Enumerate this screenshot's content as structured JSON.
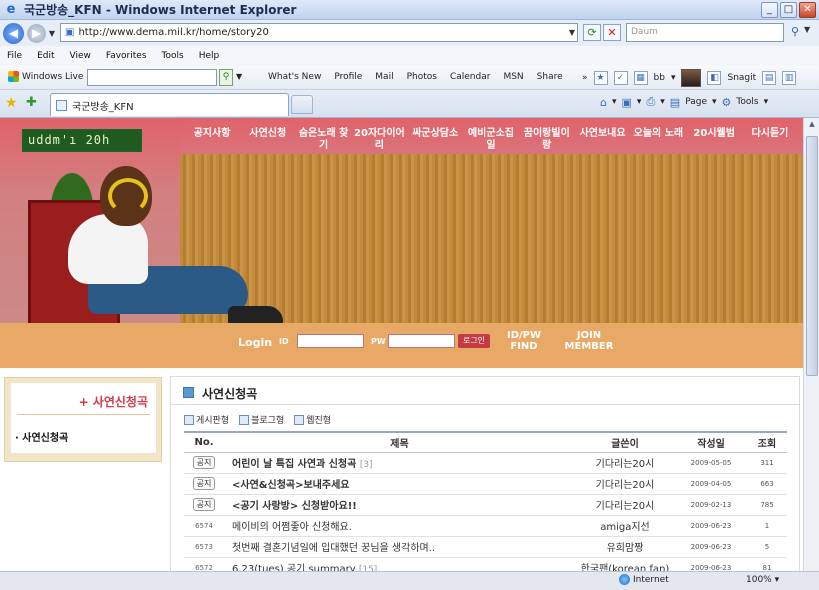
{
  "window": {
    "title": "국군방송_KFN - Windows Internet Explorer"
  },
  "address": {
    "url": "http://www.dema.mil.kr/home/story20",
    "search_placeholder": "Daum"
  },
  "menu": [
    "File",
    "Edit",
    "View",
    "Favorites",
    "Tools",
    "Help"
  ],
  "live_toolbar": {
    "brand": "Windows Live",
    "links": [
      "What's New",
      "Profile",
      "Mail",
      "Photos",
      "Calendar",
      "MSN",
      "Share"
    ],
    "user": "bb",
    "snagit": "Snagit"
  },
  "tabs": [
    {
      "label": "국군방송_KFN"
    }
  ],
  "command_bar": {
    "page": "Page",
    "tools": "Tools"
  },
  "site": {
    "logo": "uddm'ı 20h",
    "nav": [
      "공지사항",
      "사연신청",
      "숨은노래 찾기",
      "20자다이어리",
      "싸군상담소",
      "예비군소집일",
      "꿈이랑빌이랑",
      "사연보내요",
      "오늘의 노래",
      "20시웰범",
      "다시듣기"
    ],
    "login": {
      "label": "Login",
      "id_label": "ID",
      "pw_label": "PW",
      "button": "로그인",
      "find": "ID/PW FIND",
      "join": "JOIN MEMBER"
    }
  },
  "sidebar": {
    "title": "+ 사연신청곡",
    "items": [
      "· 사연신청곡"
    ]
  },
  "board": {
    "title": "사연신청곡",
    "view_tabs": [
      "게시판형",
      "블로그형",
      "웹진형"
    ],
    "columns": [
      "No.",
      "제목",
      "글쓴이",
      "작성일",
      "조회"
    ],
    "rows": [
      {
        "no": "공지",
        "notice": true,
        "title": "어린이 날 특집 사연과 신청곡",
        "comments": "[3]",
        "author": "기다리는20시",
        "date": "2009-05-05",
        "hits": "311"
      },
      {
        "no": "공지",
        "notice": true,
        "title": "<사연&신청곡>보내주세요",
        "comments": "",
        "author": "기다리는20시",
        "date": "2009-04-05",
        "hits": "663"
      },
      {
        "no": "공지",
        "notice": true,
        "title": "<공기 사랑방> 신청받아요!!",
        "comments": "",
        "author": "기다리는20시",
        "date": "2009-02-13",
        "hits": "785"
      },
      {
        "no": "6574",
        "notice": false,
        "title": "메이비의 어쩜좋아 신청해요.",
        "comments": "",
        "author": "amiga지선",
        "date": "2009-06-23",
        "hits": "1"
      },
      {
        "no": "6573",
        "notice": false,
        "title": "첫번째 결혼기념일에 입대했던 꿍님을 생각하며..",
        "comments": "",
        "author": "유희맘짱",
        "date": "2009-06-23",
        "hits": "5"
      },
      {
        "no": "6572",
        "notice": false,
        "title": "6.23(tues) 공기 summary",
        "comments": "[15]",
        "author": "한국팬(korean fan)",
        "date": "2009-06-23",
        "hits": "81"
      }
    ]
  },
  "status": {
    "zone": "Internet",
    "zoom": "100%"
  }
}
